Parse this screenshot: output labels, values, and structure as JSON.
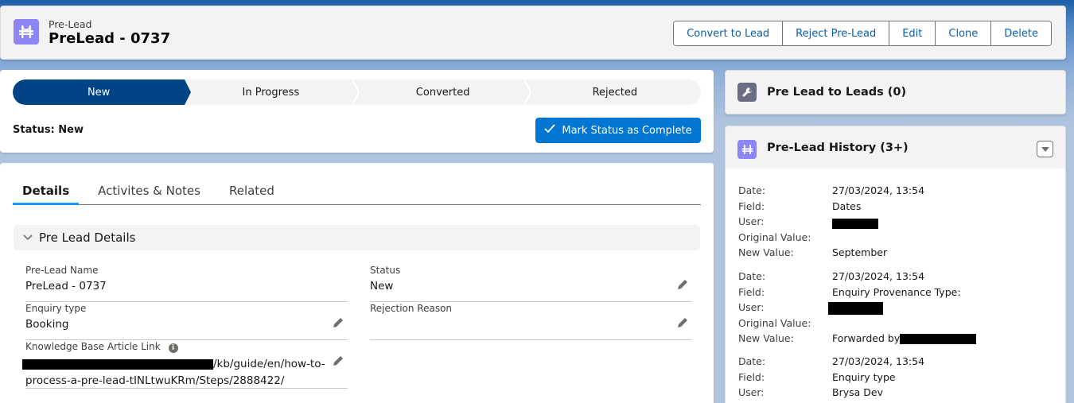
{
  "header": {
    "object_type": "Pre-Lead",
    "record_name": "PreLead - 0737",
    "icon": "bridge-icon",
    "actions": [
      "Convert to Lead",
      "Reject Pre-Lead",
      "Edit",
      "Clone",
      "Delete"
    ]
  },
  "path": {
    "stages": [
      "New",
      "In Progress",
      "Converted",
      "Rejected"
    ],
    "active_stage": "New",
    "status_text": "Status: New",
    "mark_complete_label": "Mark Status as Complete",
    "colors": {
      "active": "#014486",
      "button": "#0176d3"
    }
  },
  "tabs": {
    "items": [
      "Details",
      "Activites & Notes",
      "Related"
    ],
    "active": "Details"
  },
  "details": {
    "section_title": "Pre Lead Details",
    "fields": {
      "prelead_name": {
        "label": "Pre-Lead Name",
        "value": "PreLead - 0737"
      },
      "status": {
        "label": "Status",
        "value": "New"
      },
      "enquiry_type": {
        "label": "Enquiry type",
        "value": "Booking"
      },
      "rejection_reason": {
        "label": "Rejection Reason",
        "value": ""
      },
      "kb_link": {
        "label": "Knowledge Base Article Link",
        "value_line1": "/kb/guide/en/how-to-",
        "value_line2": "process-a-pre-lead-tINLtwuKRm/Steps/2888422/"
      }
    }
  },
  "side": {
    "related_card": {
      "title": "Pre Lead to Leads (0)",
      "icon": "wrench-icon"
    },
    "history_card": {
      "title": "Pre-Lead History (3+)",
      "icon": "bridge-icon",
      "labels": {
        "date": "Date:",
        "field": "Field:",
        "user": "User:",
        "original": "Original Value:",
        "new": "New Value:"
      },
      "entries": [
        {
          "date": "27/03/2024, 13:54",
          "field": "Dates",
          "user": "",
          "original": "",
          "new": "September"
        },
        {
          "date": "27/03/2024, 13:54",
          "field": "Enquiry Provenance Type:",
          "user": "",
          "original": "",
          "new": "Forwarded by"
        },
        {
          "date": "27/03/2024, 13:54",
          "field": "Enquiry type",
          "user": "Brysa Dev"
        }
      ]
    }
  }
}
